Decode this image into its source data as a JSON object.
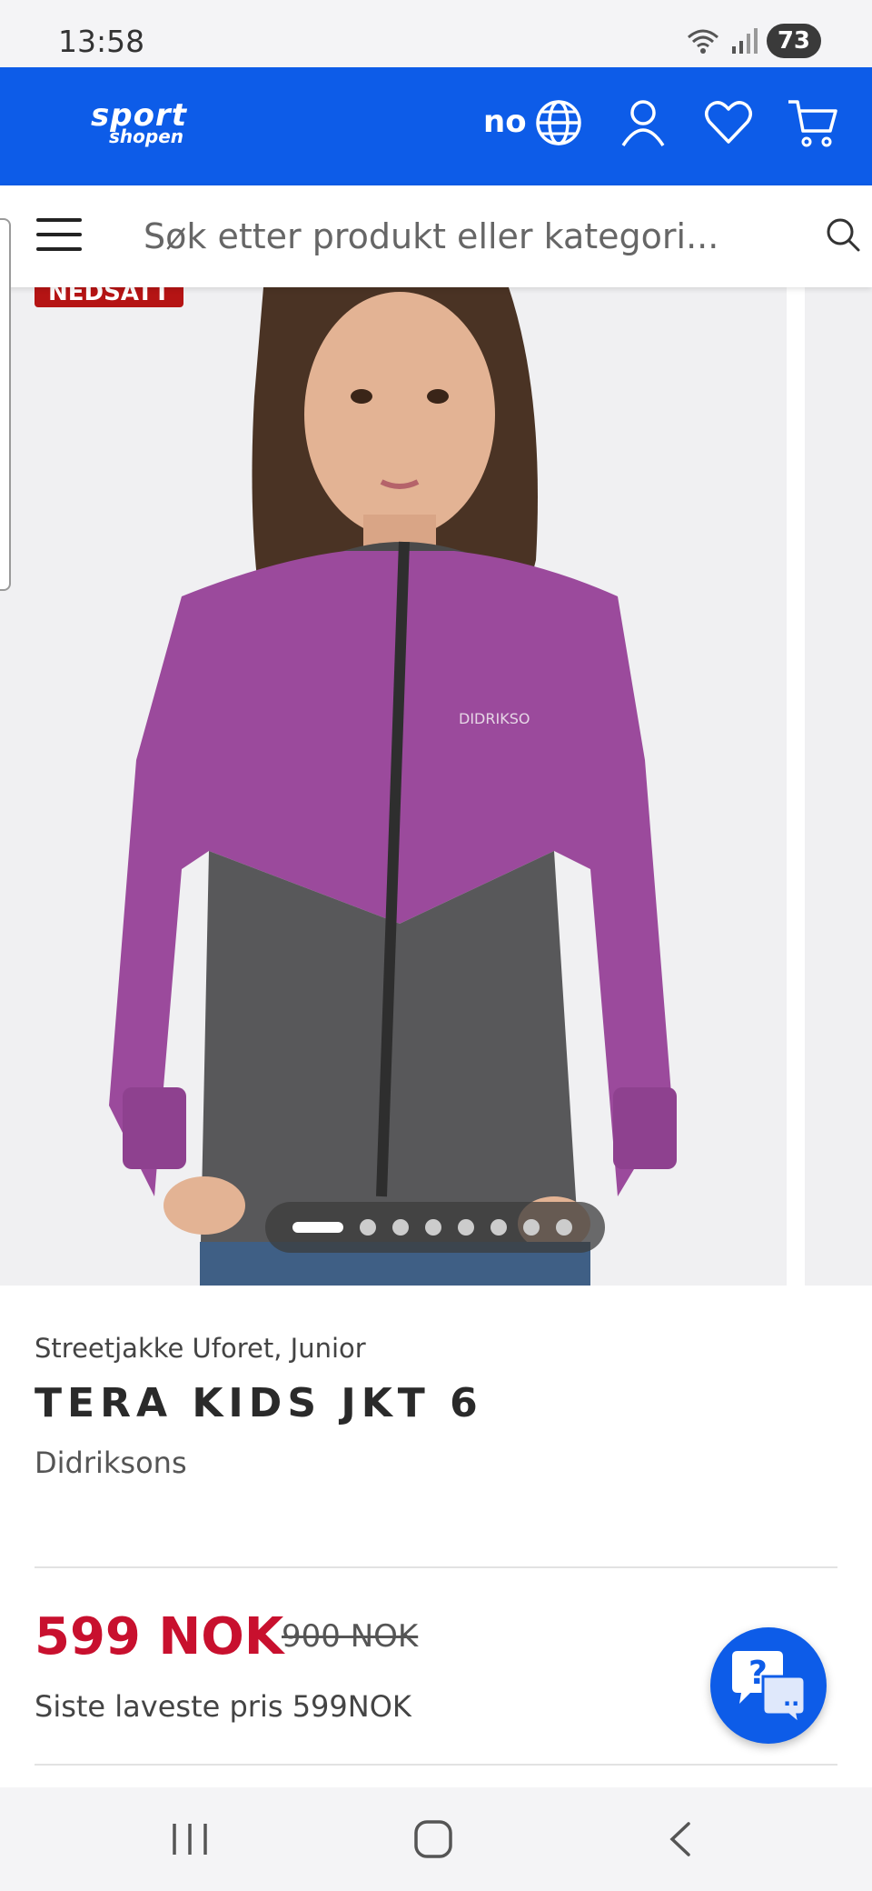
{
  "status_bar": {
    "time": "13:58",
    "battery": "73"
  },
  "header": {
    "logo_top": "sport",
    "logo_bottom": "shopen",
    "language": "no",
    "brand_color": "#0d5ce8",
    "icons": [
      "globe-icon",
      "account-icon",
      "heart-icon",
      "cart-icon"
    ]
  },
  "search": {
    "placeholder": "Søk etter produkt eller kategori..."
  },
  "gallery": {
    "badge": "NEDSATT",
    "image_count": 8,
    "active_index": 0
  },
  "product": {
    "category": "Streetjakke Uforet, Junior",
    "name": "TERA KIDS JKT 6",
    "brand": "Didriksons",
    "jacket_print": "DIDRIKSO",
    "price": "599 NOK",
    "old_price": "900 NOK",
    "lowest_price": "Siste laveste pris 599NOK",
    "price_color": "#c8102e"
  },
  "chat": {
    "question_mark": "?",
    "ellipsis": ".."
  }
}
